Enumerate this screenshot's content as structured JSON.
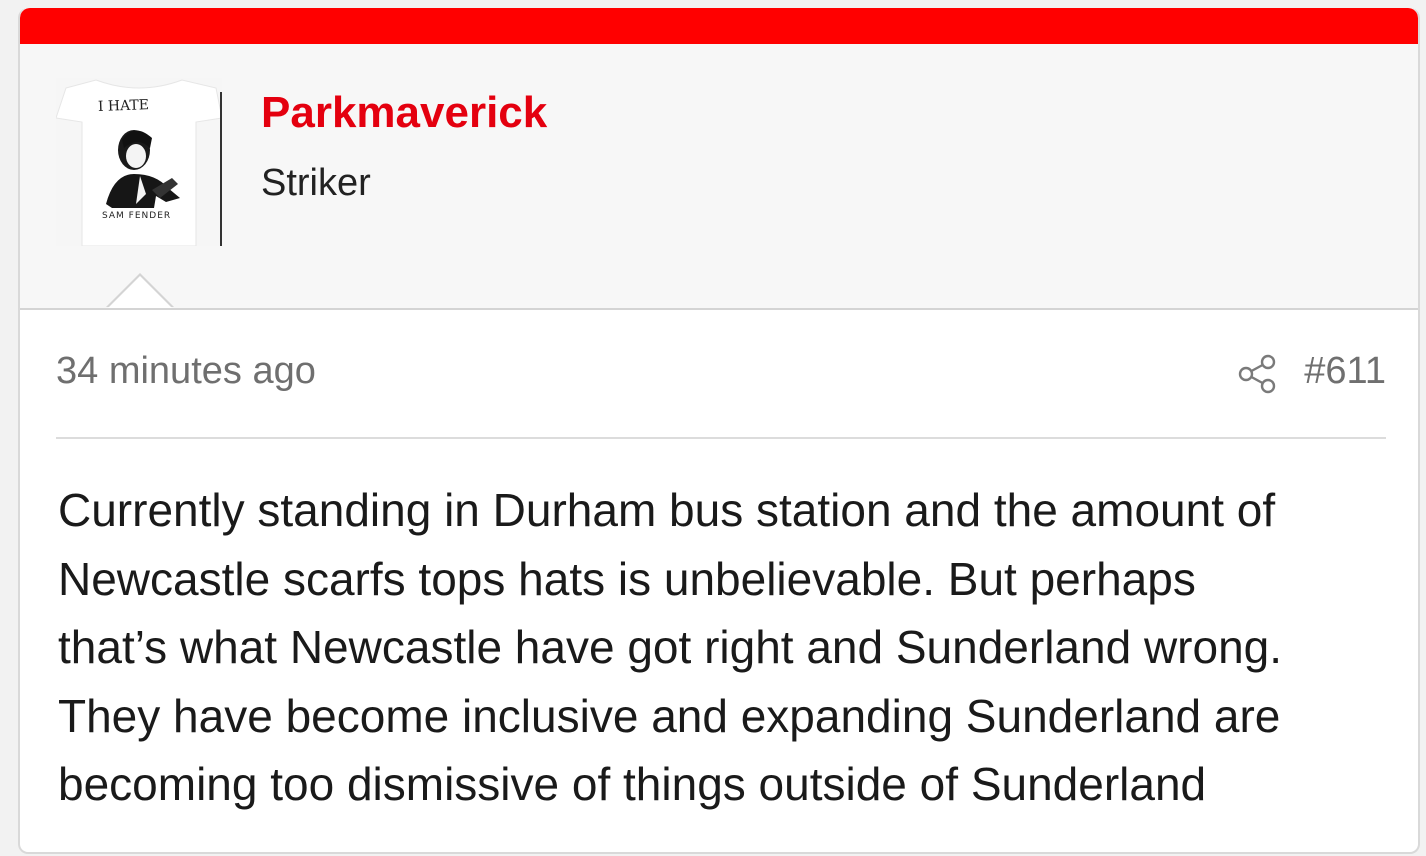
{
  "post": {
    "author": {
      "username": "Parkmaverick",
      "title": "Striker",
      "avatar": {
        "icon": "tshirt-avatar",
        "top_text": "I HATE",
        "bottom_text": "SAM FENDER"
      }
    },
    "timestamp": "34 minutes ago",
    "share_icon": "share-icon",
    "post_number": "#611",
    "body_lines": [
      "Currently standing in Durham bus station and the amount of",
      "Newcastle scarfs tops hats is unbelievable. But perhaps",
      "that’s what Newcastle have got right and Sunderland wrong.",
      "They have become inclusive and expanding Sunderland are",
      "becoming too dismissive of things outside of Sunderland"
    ]
  },
  "colors": {
    "accent": "#ff0000",
    "username": "#e4000f",
    "muted_text": "#6f6f6f",
    "header_bg": "#f7f7f7"
  }
}
